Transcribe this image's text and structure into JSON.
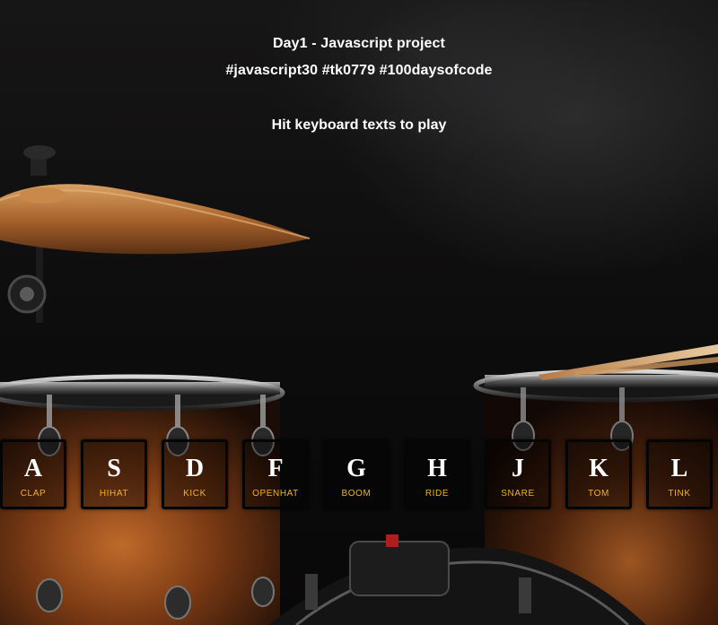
{
  "header": {
    "title": "Day1 - Javascript project",
    "tags": "#javascript30 #tk0779 #100daysofcode",
    "hint": "Hit keyboard texts to play"
  },
  "keys": [
    {
      "letter": "A",
      "sound": "clap"
    },
    {
      "letter": "S",
      "sound": "hihat"
    },
    {
      "letter": "D",
      "sound": "kick"
    },
    {
      "letter": "F",
      "sound": "openhat"
    },
    {
      "letter": "G",
      "sound": "boom"
    },
    {
      "letter": "H",
      "sound": "ride"
    },
    {
      "letter": "J",
      "sound": "snare"
    },
    {
      "letter": "K",
      "sound": "tom"
    },
    {
      "letter": "L",
      "sound": "tink"
    }
  ],
  "colors": {
    "label_accent": "#f2b21d",
    "key_text": "#ffffff",
    "key_border": "#050505"
  }
}
